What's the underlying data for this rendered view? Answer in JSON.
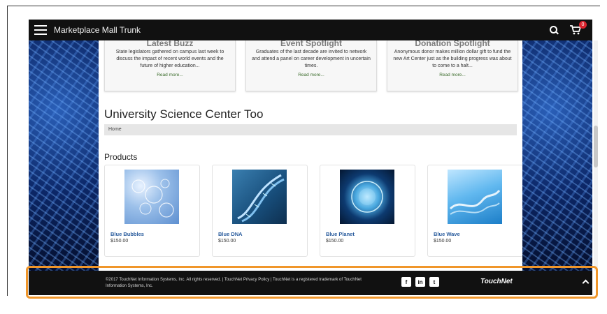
{
  "header": {
    "brand": "Marketplace Mall Trunk",
    "cart_count": "0"
  },
  "buzz": [
    {
      "title": "Latest Buzz",
      "text": "State legislators gathered on campus last week to discuss the impact of recent world events and the future of higher education...",
      "more": "Read more..."
    },
    {
      "title": "Event Spotlight",
      "text": "Graduates of the last decade are invited to network and attend a panel on career development in uncertain times.",
      "more": "Read more..."
    },
    {
      "title": "Donation Spotlight",
      "text": "Anonymous donor makes million dollar gift to fund the new Art Center just as the building progress was about to come to a halt...",
      "more": "Read more..."
    }
  ],
  "page": {
    "title": "University Science Center Too",
    "breadcrumb": "Home",
    "products_heading": "Products"
  },
  "products": [
    {
      "name": "Blue Bubbles",
      "price": "$150.00"
    },
    {
      "name": "Blue DNA",
      "price": "$150.00"
    },
    {
      "name": "Blue Planet",
      "price": "$150.00"
    },
    {
      "name": "Blue Wave",
      "price": "$150.00"
    }
  ],
  "footer": {
    "copyright": "©2017 TouchNet Information Systems, Inc. All rights reserved. | TouchNet Privacy Policy | TouchNet is a registered trademark of TouchNet Information Systems, Inc.",
    "social": [
      "f",
      "in",
      "t"
    ],
    "logo": "TouchNet"
  },
  "colors": {
    "highlight": "#f0962a",
    "nav_bg": "#111111",
    "product_link": "#2b5d9e",
    "cart_badge": "#d9232d"
  },
  "icons": [
    "hamburger-menu-icon",
    "search-icon",
    "cart-icon",
    "facebook-icon",
    "linkedin-icon",
    "twitter-icon",
    "chevron-up-icon"
  ]
}
